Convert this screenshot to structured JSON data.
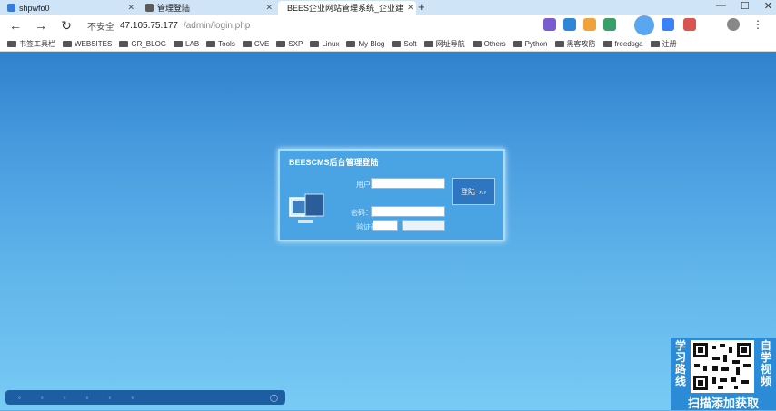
{
  "tabs": [
    {
      "label": "shpwfo0"
    },
    {
      "label": "管理登陆"
    },
    {
      "label": "BEES企业网站管理系统_企业建"
    }
  ],
  "addressbar": {
    "security": "不安全",
    "url": "47.105.75.177",
    "path": "/admin/login.php"
  },
  "bookmarks": [
    {
      "label": "书签工具栏"
    },
    {
      "label": "WEBSITES"
    },
    {
      "label": "GR_BLOG"
    },
    {
      "label": "LAB"
    },
    {
      "label": "Tools"
    },
    {
      "label": "CVE"
    },
    {
      "label": "SXP"
    },
    {
      "label": "Linux"
    },
    {
      "label": "My Blog"
    },
    {
      "label": "Soft"
    },
    {
      "label": "网址导航"
    },
    {
      "label": "Others"
    },
    {
      "label": "Python"
    },
    {
      "label": "黑客攻防"
    },
    {
      "label": "freedsga"
    },
    {
      "label": "注册"
    }
  ],
  "login": {
    "title": "BEESCMS后台管理登陆",
    "user_label": "用户名：",
    "pass_label": "密码：",
    "captcha_label": "验证码",
    "submit_label": "登陆"
  },
  "promo": {
    "left_text": "学习路线",
    "right_text": "自学视频",
    "bottom_text": "扫描添加获取"
  },
  "colors": {
    "page_bg": "#5fb0e6",
    "login_panel": "#4aa3e3",
    "promo_bg": "#2b8bd6"
  }
}
